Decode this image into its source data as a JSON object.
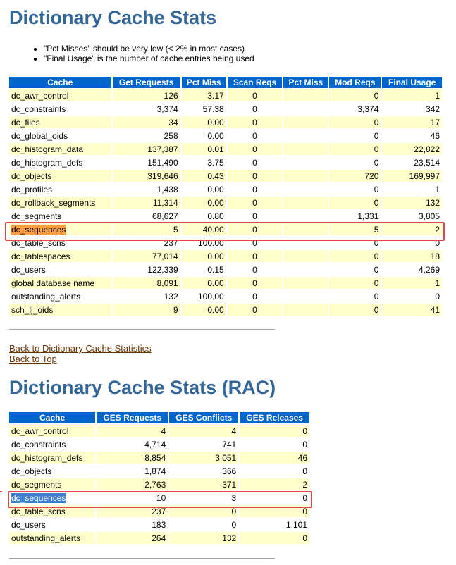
{
  "sections": [
    {
      "title": "Dictionary Cache Stats"
    },
    {
      "title": "Dictionary Cache Stats (RAC)"
    }
  ],
  "notes": [
    "\"Pct Misses\" should be very low (< 2% in most cases)",
    "\"Final Usage\" is the number of cache entries being used"
  ],
  "cache_table": {
    "headers": [
      "Cache",
      "Get Requests",
      "Pct Miss",
      "Scan Reqs",
      "Pct Miss",
      "Mod Reqs",
      "Final Usage"
    ],
    "rows": [
      [
        "dc_awr_control",
        "126",
        "3.17",
        "0",
        "",
        "0",
        "1"
      ],
      [
        "dc_constraints",
        "3,374",
        "57.38",
        "0",
        "",
        "3,374",
        "342"
      ],
      [
        "dc_files",
        "34",
        "0.00",
        "0",
        "",
        "0",
        "17"
      ],
      [
        "dc_global_oids",
        "258",
        "0.00",
        "0",
        "",
        "0",
        "46"
      ],
      [
        "dc_histogram_data",
        "137,387",
        "0.01",
        "0",
        "",
        "0",
        "22,822"
      ],
      [
        "dc_histogram_defs",
        "151,490",
        "3.75",
        "0",
        "",
        "0",
        "23,514"
      ],
      [
        "dc_objects",
        "319,646",
        "0.43",
        "0",
        "",
        "720",
        "169,997"
      ],
      [
        "dc_profiles",
        "1,438",
        "0.00",
        "0",
        "",
        "0",
        "1"
      ],
      [
        "dc_rollback_segments",
        "11,314",
        "0.00",
        "0",
        "",
        "0",
        "132"
      ],
      [
        "dc_segments",
        "68,627",
        "0.80",
        "0",
        "",
        "1,331",
        "3,805"
      ],
      [
        "dc_sequences",
        "5",
        "40.00",
        "0",
        "",
        "5",
        "2"
      ],
      [
        "dc_table_scns",
        "237",
        "100.00",
        "0",
        "",
        "0",
        "0"
      ],
      [
        "dc_tablespaces",
        "77,014",
        "0.00",
        "0",
        "",
        "0",
        "18"
      ],
      [
        "dc_users",
        "122,339",
        "0.15",
        "0",
        "",
        "0",
        "4,269"
      ],
      [
        "global database name",
        "8,091",
        "0.00",
        "0",
        "",
        "0",
        "1"
      ],
      [
        "outstanding_alerts",
        "132",
        "100.00",
        "0",
        "",
        "0",
        "0"
      ],
      [
        "sch_lj_oids",
        "9",
        "0.00",
        "0",
        "",
        "0",
        "41"
      ]
    ]
  },
  "links": {
    "back_to_section": "Back to Dictionary Cache Statistics",
    "back_to_top": "Back to Top"
  },
  "rac_table": {
    "headers": [
      "Cache",
      "GES Requests",
      "GES Conflicts",
      "GES Releases"
    ],
    "rows": [
      [
        "dc_awr_control",
        "4",
        "4",
        "0"
      ],
      [
        "dc_constraints",
        "4,714",
        "741",
        "0"
      ],
      [
        "dc_histogram_defs",
        "8,854",
        "3,051",
        "46"
      ],
      [
        "dc_objects",
        "1,874",
        "366",
        "0"
      ],
      [
        "dc_segments",
        "2,763",
        "371",
        "2"
      ],
      [
        "dc_sequences",
        "10",
        "3",
        "0"
      ],
      [
        "dc_table_scns",
        "237",
        "0",
        "0"
      ],
      [
        "dc_users",
        "183",
        "0",
        "1,101"
      ],
      [
        "outstanding_alerts",
        "264",
        "132",
        "0"
      ]
    ]
  },
  "highlights": {
    "row_label": "dc_sequences",
    "box_color": "#e0474c",
    "first_selection_color": "#ff9e3d",
    "second_selection_color": "#3f7fd3"
  },
  "colors": {
    "title": "#336699",
    "header_bg": "#0066cc",
    "row_odd": "#ffffcc",
    "row_even": "#ffffff",
    "link": "#663300"
  }
}
